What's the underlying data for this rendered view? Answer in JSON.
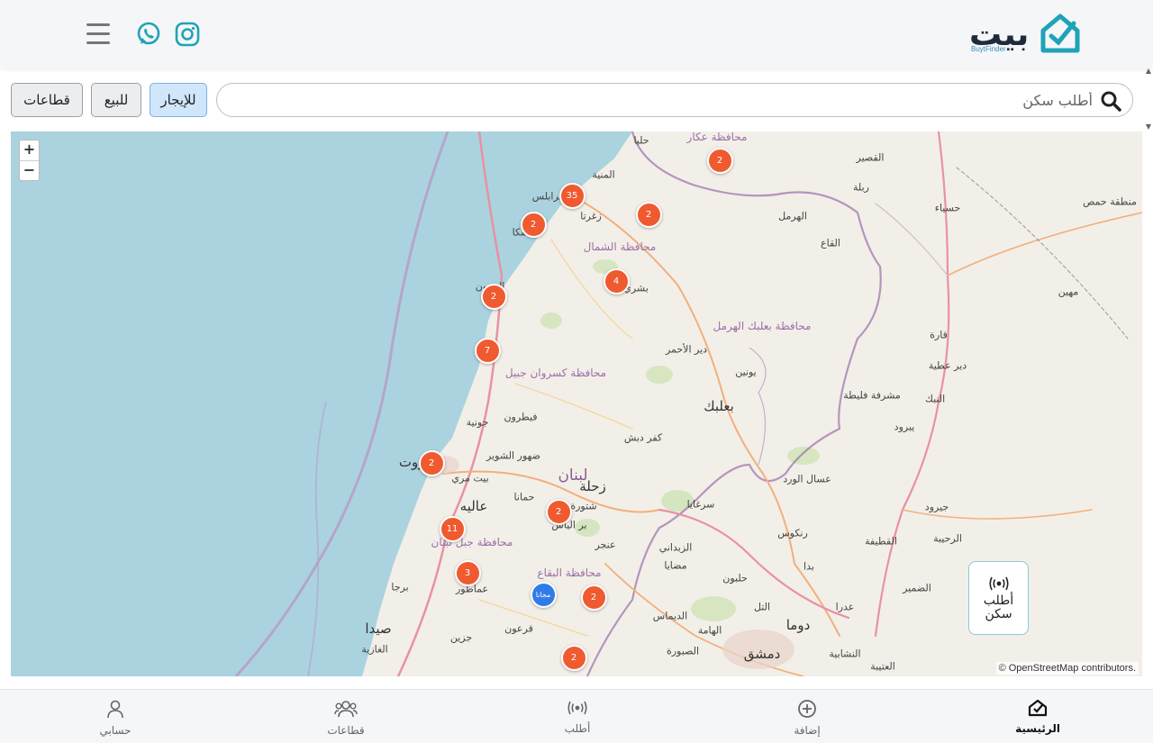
{
  "header": {
    "logo_text": "بيت",
    "logo_sub": "BuytFinder",
    "menu_icon": "hamburger-icon",
    "social": [
      "whatsapp-icon",
      "instagram-icon"
    ],
    "accent": "#1fa3b8"
  },
  "search": {
    "placeholder": "أطلب سكن",
    "icon": "search-icon"
  },
  "filters": {
    "rent": "للإيجار",
    "sale": "للبيع",
    "sectors": "قطاعات",
    "active": "rent"
  },
  "map": {
    "zoom_in": "+",
    "zoom_out": "−",
    "attribution_sym": "©",
    "attribution_link": "OpenStreetMap",
    "attribution_rest": "contributors.",
    "markers": [
      "2",
      "35",
      "2",
      "2",
      "4",
      "2",
      "7",
      "2",
      "11",
      "2",
      "3",
      "مجانا",
      "2",
      "2"
    ],
    "places": {
      "akkar": "محافظة عكار",
      "halba": "حلبا",
      "qusayr": "القصير",
      "minieh": "المنية",
      "homs_region": "منطقة حمص",
      "ribla": "ربلة",
      "hisya": "حسياء",
      "hermel": "الهرمل",
      "zgharta": "زغرتا",
      "north": "محافظة الشمال",
      "qaa": "القاع",
      "tripoli": "طرابلس",
      "chekka": "شكا",
      "batroun": "البترون",
      "bsharri": "بشري",
      "mahin": "مهين",
      "baalbek_hermel": "محافظة بعلبك الهرمل",
      "qara": "قارة",
      "deir_ahmar": "دير الأحمر",
      "deir_atiyeh": "دير عطية",
      "keserwan_jbeil": "محافظة كسروان جبيل",
      "yammouneh": "يونين",
      "nabk": "النبك",
      "mushrafa": "مشرفة فليطة",
      "baalbek": "بعلبك",
      "jounieh": "جونية",
      "faitroun": "فيطرون",
      "kfardebian": "كفر دبش",
      "yabrud": "يبرود",
      "beirut": "بيروت",
      "dhour": "ضهور الشوير",
      "lebanon": "لبنان",
      "beit_meri": "بيت مري",
      "zahle": "زحلة",
      "assal": "عسال الورد",
      "hammana": "حمانا",
      "aley": "عاليه",
      "chtaura": "شتورة",
      "sarghaya": "سرغايا",
      "jayroud": "جيرود",
      "mount_lebanon": "محافظة جبل لبنان",
      "bar_elias": "بر الياس",
      "rankous": "رنكوس",
      "anjar": "عنجر",
      "zabadani": "الزبداني",
      "qutayfa": "القطيفة",
      "ruhaybah": "الرحيبة",
      "madaya": "مضايا",
      "bekaa": "محافظة البقاع",
      "baddah": "بدا",
      "dumayr": "الضمير",
      "amatour": "عماطور",
      "barja": "برجا",
      "halboun": "حلبون",
      "tall": "التل",
      "adra": "عدرا",
      "douma": "دوما",
      "qaraoun": "قرعون",
      "saida": "صيدا",
      "dimas": "الديماس",
      "hameh": "الهامة",
      "jezzine": "جزين",
      "ghaziyeh": "الغازية",
      "sabboura": "الصبورة",
      "damascus": "دمشق",
      "nashabiyeh": "النشابية",
      "ateibeh": "العتيبة"
    }
  },
  "request_button": {
    "line1": "أطلب",
    "line2": "سكن",
    "icon": "broadcast-icon"
  },
  "bottom_nav": [
    {
      "label": "الرئيسية",
      "icon": "home-icon",
      "active": true
    },
    {
      "label": "إضافة",
      "icon": "plus-circle-icon",
      "active": false
    },
    {
      "label": "أطلب",
      "icon": "broadcast-icon",
      "active": false
    },
    {
      "label": "قطاعات",
      "icon": "users-icon",
      "active": false
    },
    {
      "label": "حسابي",
      "icon": "user-icon",
      "active": false
    }
  ],
  "colors": {
    "marker": "#f05a2f",
    "marker_free": "#2f7ce8",
    "sea": "#aad3df",
    "land": "#f2efe9"
  }
}
